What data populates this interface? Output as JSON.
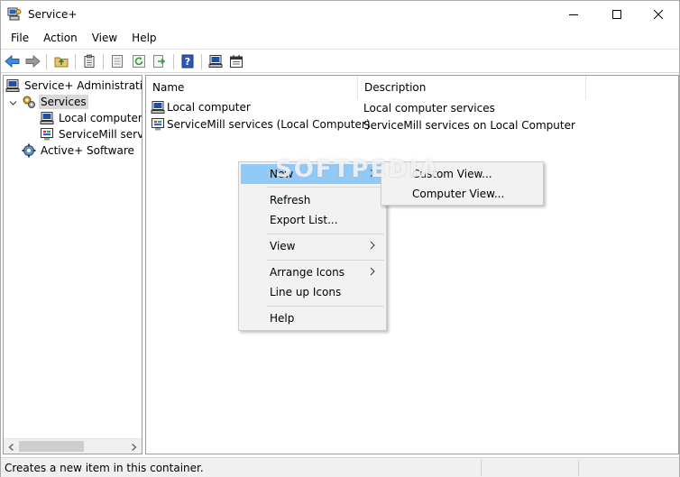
{
  "window": {
    "title": "Service+"
  },
  "menubar": {
    "items": [
      {
        "label": "File"
      },
      {
        "label": "Action"
      },
      {
        "label": "View"
      },
      {
        "label": "Help"
      }
    ]
  },
  "toolbar": {
    "buttons": [
      "back-arrow-icon",
      "forward-arrow-icon",
      "up-folder-icon",
      "clipboard-icon",
      "properties-icon",
      "refresh-icon",
      "export-icon",
      "help-icon",
      "computer-icon",
      "calendar-icon"
    ]
  },
  "tree": {
    "items": [
      {
        "label": "Service+ Administration",
        "icon": "computer-icon"
      },
      {
        "label": "Services",
        "icon": "gears-icon"
      },
      {
        "label": "Local computer",
        "icon": "computer-icon"
      },
      {
        "label": "ServiceMill servic",
        "icon": "monitor-icon"
      },
      {
        "label": "Active+ Software",
        "icon": "gear-icon"
      }
    ]
  },
  "list": {
    "columns": [
      "Name",
      "Description"
    ],
    "rows": [
      {
        "name": "Local computer",
        "description": "Local computer services",
        "icon": "computer-icon"
      },
      {
        "name": "ServiceMill services (Local Computer)",
        "description": "ServiceMill services on Local Computer",
        "icon": "monitor-icon"
      }
    ]
  },
  "context_menu": {
    "items": [
      {
        "label": "New",
        "has_submenu": true,
        "highlighted": true
      },
      {
        "label": "Refresh"
      },
      {
        "label": "Export List..."
      },
      {
        "label": "View",
        "has_submenu": true
      },
      {
        "label": "Arrange Icons",
        "has_submenu": true
      },
      {
        "label": "Line up Icons"
      },
      {
        "label": "Help"
      }
    ],
    "submenu_items": [
      {
        "label": "Custom View..."
      },
      {
        "label": "Computer View..."
      }
    ]
  },
  "watermark": "SOFTPEDIA",
  "statusbar": {
    "text": "Creates a new item in this container."
  },
  "colors": {
    "highlight": "#91c9f7",
    "selection": "#d9d9d9",
    "menu_bg": "#f2f2f2"
  }
}
